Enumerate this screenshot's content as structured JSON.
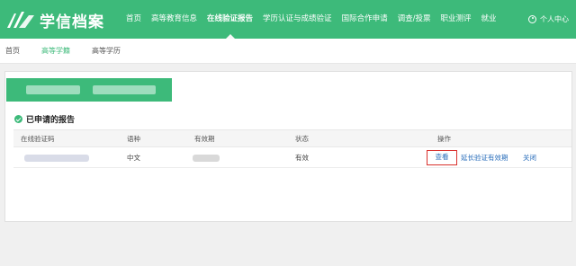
{
  "header": {
    "logo_text": "学信档案",
    "nav": [
      "首页",
      "高等教育信息",
      "在线验证报告",
      "学历认证与成绩验证",
      "国际合作申请",
      "调查/投票",
      "职业测评",
      "就业"
    ],
    "active_nav_index": 2,
    "user_label": "个人中心"
  },
  "subnav": {
    "items": [
      "首页",
      "高等学籍",
      "高等学历"
    ],
    "active_index": 1
  },
  "section": {
    "title": "已申请的报告"
  },
  "table": {
    "columns": [
      "在线验证码",
      "语种",
      "有效期",
      "状态",
      "操作"
    ],
    "rows": [
      {
        "language": "中文",
        "status": "有效"
      }
    ],
    "actions": {
      "view": "查看",
      "extend": "延长验证有效期",
      "close": "关闭"
    }
  },
  "colors": {
    "brand": "#3dba7a",
    "link": "#2a6ebb",
    "highlight": "#d9302c"
  }
}
